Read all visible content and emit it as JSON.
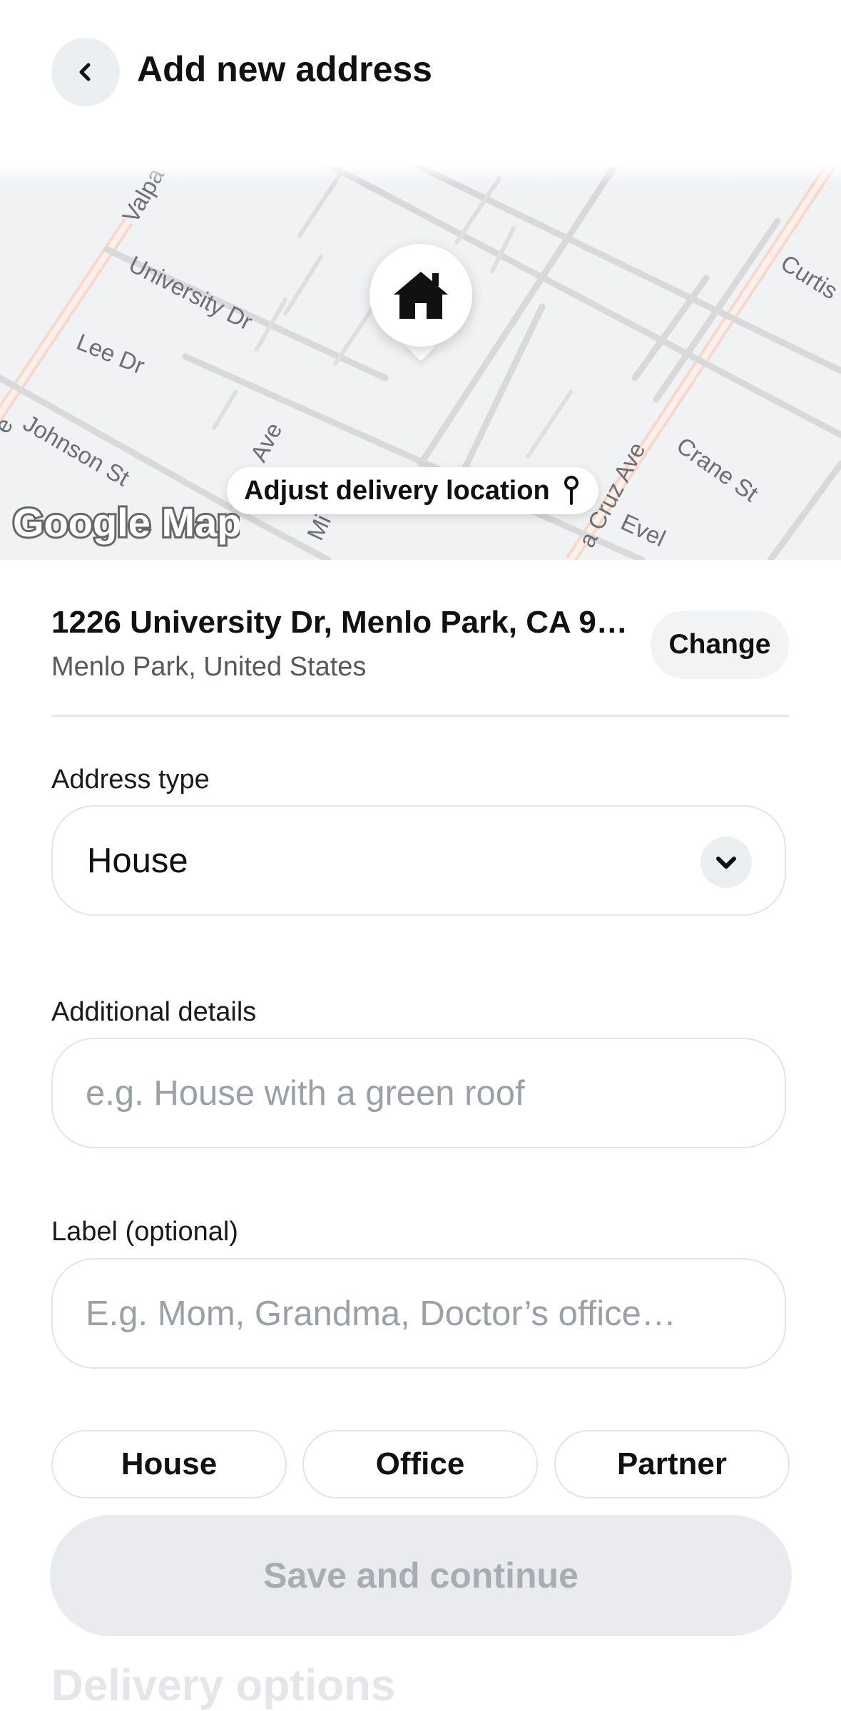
{
  "header": {
    "title": "Add new address"
  },
  "map": {
    "adjust_label": "Adjust delivery location",
    "attribution": "Google Maps",
    "street_labels": {
      "valpa": "Valpa",
      "university": "University Dr",
      "lee": "Lee Dr",
      "johnson": "Johnson St",
      "ave_left": "Ave",
      "ave_edge": "e",
      "mi": "Mi",
      "cruz": "a Cruz Ave",
      "crane": "Crane St",
      "evel": "Evel",
      "curtis": "Curtis"
    }
  },
  "address": {
    "line1": "1226 University Dr, Menlo Park, CA 9…",
    "line2": "Menlo Park, United States",
    "change_label": "Change"
  },
  "address_type": {
    "label": "Address type",
    "value": "House"
  },
  "additional_details": {
    "label": "Additional details",
    "placeholder": "e.g. House with a green roof"
  },
  "label_field": {
    "label": "Label (optional)",
    "placeholder": "E.g. Mom, Grandma, Doctor’s office…"
  },
  "label_chips": [
    "House",
    "Office",
    "Partner"
  ],
  "save_label": "Save and continue",
  "next_section_title": "Delivery options"
}
